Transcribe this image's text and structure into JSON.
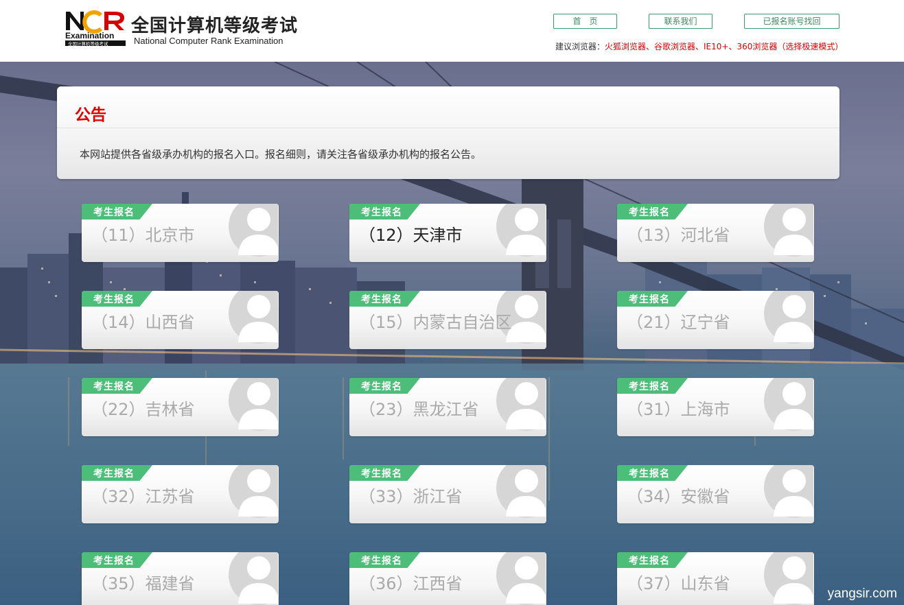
{
  "header": {
    "logo_text": "NCR",
    "logo_sub": "Examination",
    "logo_caption": "全国计算机等级考试",
    "title": "全国计算机等级考试",
    "subtitle": "National Computer Rank Examination",
    "nav": {
      "home": "首　页",
      "contact": "联系我们",
      "recover": "已报名账号找回"
    },
    "browser_hint_label": "建议浏览器：",
    "browser_hint_value": "火狐浏览器、谷歌浏览器、IE10+、360浏览器（选择极速模式）"
  },
  "notice": {
    "title": "公告",
    "body": "本网站提供各省级承办机构的报名入口。报名细则，请关注各省级承办机构的报名公告。"
  },
  "badge_label": "考生报名",
  "provinces": [
    {
      "label": "（11）北京市",
      "active": false
    },
    {
      "label": "（12）天津市",
      "active": true
    },
    {
      "label": "（13）河北省",
      "active": false
    },
    {
      "label": "（14）山西省",
      "active": false
    },
    {
      "label": "（15）内蒙古自治区",
      "active": false
    },
    {
      "label": "（21）辽宁省",
      "active": false
    },
    {
      "label": "（22）吉林省",
      "active": false
    },
    {
      "label": "（23）黑龙江省",
      "active": false
    },
    {
      "label": "（31）上海市",
      "active": false
    },
    {
      "label": "（32）江苏省",
      "active": false
    },
    {
      "label": "（33）浙江省",
      "active": false
    },
    {
      "label": "（34）安徽省",
      "active": false
    },
    {
      "label": "（35）福建省",
      "active": false
    },
    {
      "label": "（36）江西省",
      "active": false
    },
    {
      "label": "（37）山东省",
      "active": false
    }
  ],
  "watermark": "yangsir.com",
  "colors": {
    "accent_green": "#4dbd7a",
    "notice_red": "#e00000",
    "hint_red": "#d40000"
  }
}
